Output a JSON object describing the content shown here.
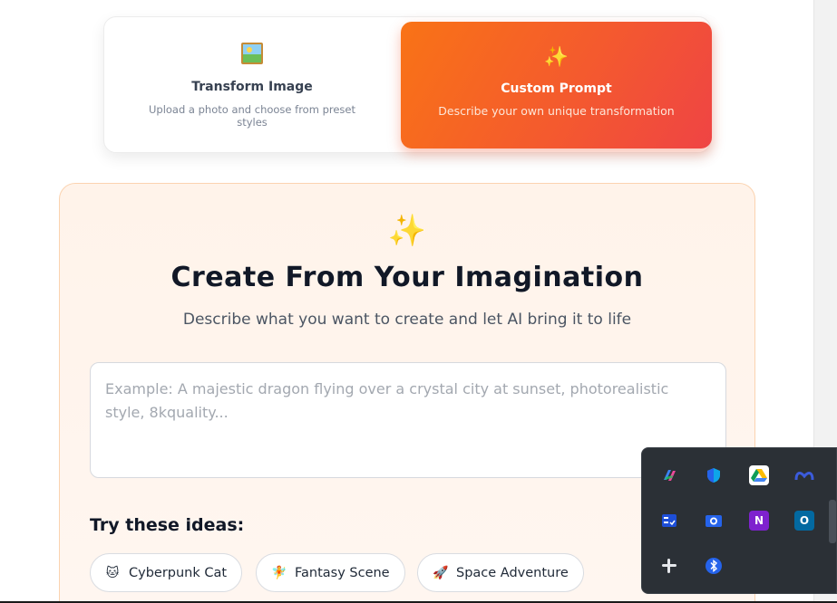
{
  "modes": {
    "transform": {
      "icon": "picture-icon",
      "title": "Transform Image",
      "description": "Upload a photo and choose from preset styles"
    },
    "custom": {
      "icon": "sparkles-icon",
      "icon_glyph": "✨",
      "title": "Custom Prompt",
      "description": "Describe your own unique transformation"
    }
  },
  "create": {
    "icon": "sparkles-icon",
    "icon_glyph": "✨",
    "title": "Create From Your Imagination",
    "subtitle": "Describe what you want to create and let AI bring it to life",
    "prompt_value": "",
    "prompt_placeholder": "Example: A majestic dragon flying over a crystal city at sunset, photorealistic style, 8kquality...",
    "ideas_title": "Try these ideas:",
    "ideas": [
      {
        "emoji": "🐱",
        "icon": "cat-icon",
        "label": "Cyberpunk Cat"
      },
      {
        "emoji": "🧚",
        "icon": "fairy-icon",
        "label": "Fantasy Scene"
      },
      {
        "emoji": "🚀",
        "icon": "rocket-icon",
        "label": "Space Adventure"
      }
    ]
  },
  "colors": {
    "accent_start": "#f97316",
    "accent_end": "#ef4444",
    "panel_bg": "#fff3ea",
    "panel_border": "#fbd3b0"
  },
  "tray": {
    "icons": [
      {
        "name": "copilot-icon"
      },
      {
        "name": "defender-icon"
      },
      {
        "name": "google-drive-icon"
      },
      {
        "name": "meta-icon"
      },
      {
        "name": "task-manager-icon"
      },
      {
        "name": "camera-icon"
      },
      {
        "name": "onenote-icon",
        "glyph": "N"
      },
      {
        "name": "outlook-icon",
        "glyph": "O"
      },
      {
        "name": "slack-icon"
      },
      {
        "name": "bluetooth-icon",
        "glyph": "ᛒ"
      }
    ]
  }
}
